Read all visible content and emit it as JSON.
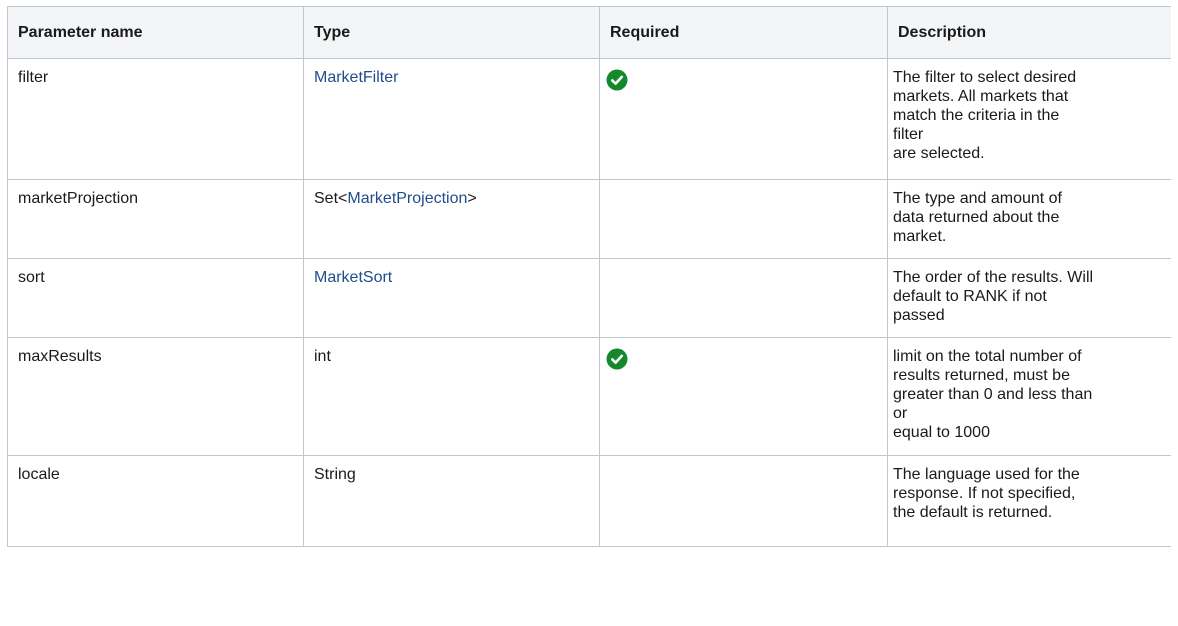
{
  "columns": [
    "Parameter name",
    "Type",
    "Required",
    "Description"
  ],
  "rows": [
    {
      "name": "filter",
      "type": {
        "prefix": "",
        "link": "MarketFilter",
        "suffix": ""
      },
      "required": true,
      "description": [
        "The filter to select desired",
        "markets. All markets that",
        "match the criteria in the",
        "filter",
        "are selected."
      ]
    },
    {
      "name": "marketProjection",
      "type": {
        "prefix": "Set<",
        "link": "MarketProjection",
        "suffix": ">"
      },
      "required": false,
      "description": [
        "The type and amount of",
        "data returned about the",
        "market."
      ]
    },
    {
      "name": "sort",
      "type": {
        "prefix": "",
        "link": "MarketSort",
        "suffix": ""
      },
      "required": false,
      "description": [
        "The order of the results. Will",
        "default to RANK if not",
        "passed"
      ]
    },
    {
      "name": "maxResults",
      "type": {
        "prefix": "int",
        "link": "",
        "suffix": ""
      },
      "required": true,
      "description": [
        "limit on the total number of",
        "results returned, must be",
        "greater than 0 and less than",
        "or",
        "equal to 1000"
      ]
    },
    {
      "name": "locale",
      "type": {
        "prefix": "String",
        "link": "",
        "suffix": ""
      },
      "required": false,
      "description": [
        "The language used for the",
        "response. If not specified,",
        "the default is returned."
      ]
    }
  ],
  "colors": {
    "header_bg": "#f4f5f7",
    "border": "#c1c7d0",
    "link": "#1f4d8b",
    "check_green": "#14892c"
  },
  "icons": {
    "required": "check-circle-icon"
  }
}
